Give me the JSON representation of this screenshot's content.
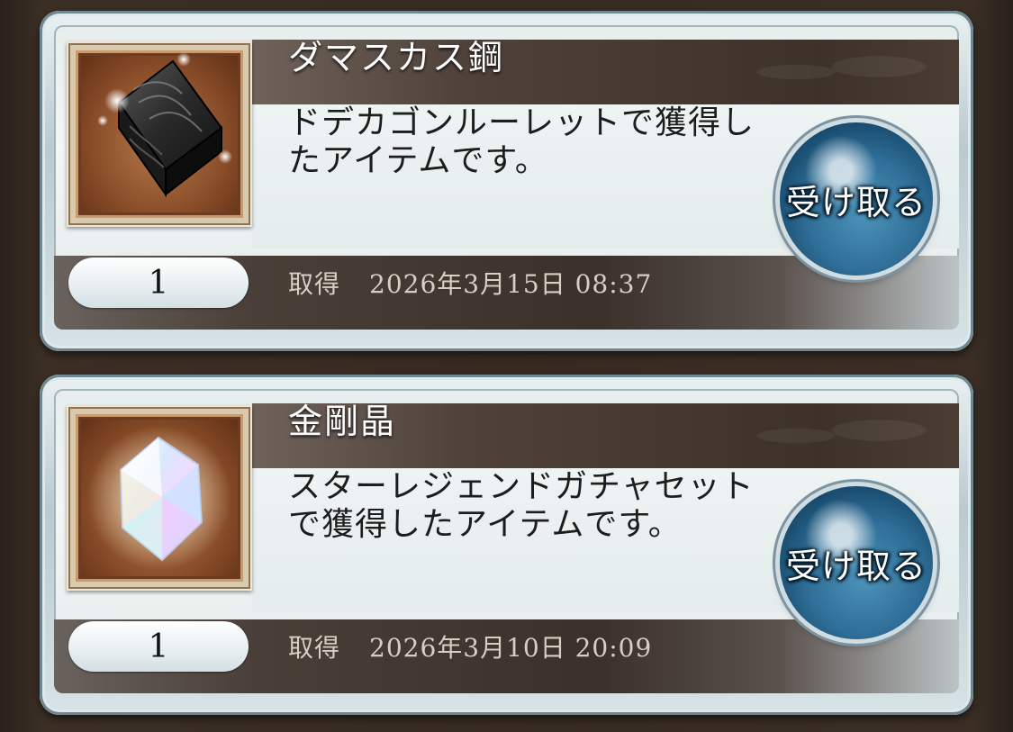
{
  "items": [
    {
      "name": "ダマスカス鋼",
      "description": "ドデカゴンルーレットで獲得したアイテムです。",
      "quantity": "1",
      "acquired_label": "取得",
      "acquired_date": "2026年3月15日 08:37",
      "receive_label": "受け取る",
      "icon": "damascus-steel-ingot-icon"
    },
    {
      "name": "金剛晶",
      "description": "スターレジェンドガチャセットで獲得したアイテムです。",
      "quantity": "1",
      "acquired_label": "取得",
      "acquired_date": "2026年3月10日 20:09",
      "receive_label": "受け取る",
      "icon": "adamantine-crystal-icon"
    }
  ],
  "colors": {
    "title_bar": "#3d312a",
    "receive_button": "#2f6f98",
    "item_frame": "#8a4e29"
  }
}
